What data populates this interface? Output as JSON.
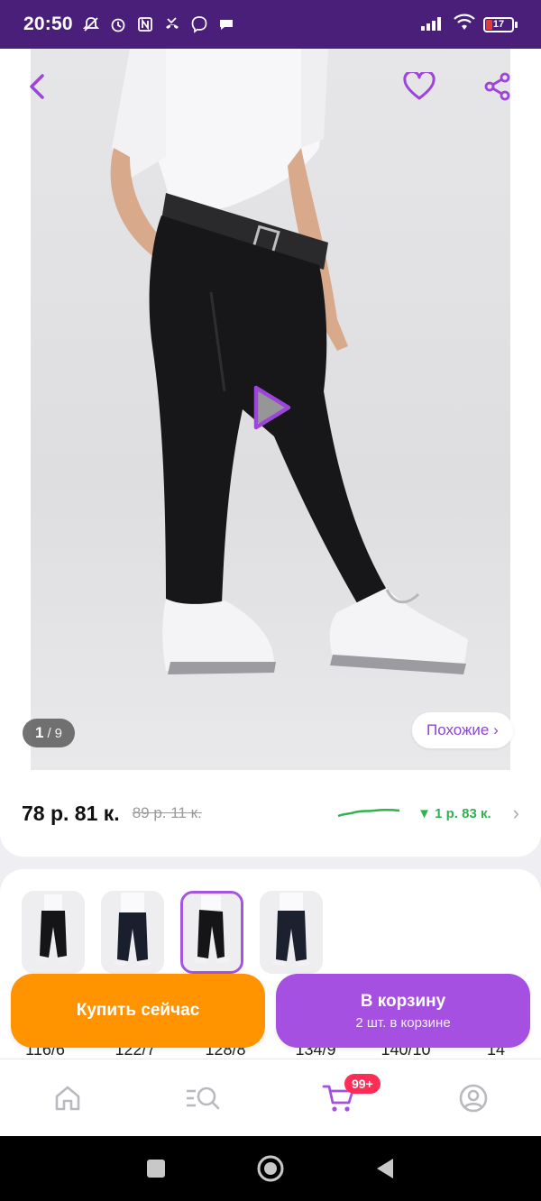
{
  "status_bar": {
    "time": "20:50",
    "battery": "17",
    "icons": [
      "mute-icon",
      "alarm-icon",
      "nfc-icon",
      "missed-call-icon",
      "viber-icon",
      "chat-icon"
    ],
    "right_icons": [
      "signal-icon",
      "wifi-icon",
      "battery-icon"
    ]
  },
  "gallery": {
    "current": "1",
    "separator": "/",
    "total": "9",
    "similar_label": "Похожие ›"
  },
  "price": {
    "current": "78 р. 81 к.",
    "old": "89 р. 11 к.",
    "change": "▼ 1 р. 83 к.",
    "change_color": "#2fb24f",
    "chevron": "›"
  },
  "thumbnails": [
    {
      "name": "thumb-1"
    },
    {
      "name": "thumb-2"
    },
    {
      "name": "thumb-3",
      "selected": true
    },
    {
      "name": "thumb-4"
    }
  ],
  "sizes": [
    "116/6",
    "122/7",
    "128/8",
    "134/9",
    "140/10",
    "14"
  ],
  "actions": {
    "buy_now": "Купить сейчас",
    "to_cart": "В корзину",
    "to_cart_sub": "2 шт. в корзине"
  },
  "bottom_nav": {
    "items": [
      "home-icon",
      "catalog-search-icon",
      "cart-icon",
      "profile-icon"
    ],
    "cart_badge": "99+"
  },
  "colors": {
    "accent": "#a550e0",
    "orange": "#ff9400",
    "status_bar": "#4a1f7a",
    "badge": "#ff2d55"
  }
}
